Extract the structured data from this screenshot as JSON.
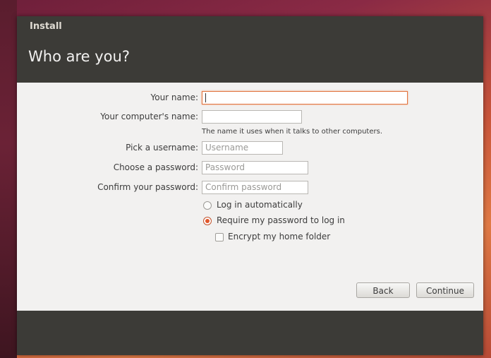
{
  "window": {
    "title": "Install"
  },
  "page": {
    "title": "Who are you?"
  },
  "form": {
    "name_label": "Your name:",
    "name_value": "",
    "computer_label": "Your computer's name:",
    "computer_value": "",
    "computer_hint": "The name it uses when it talks to other computers.",
    "username_label": "Pick a username:",
    "username_placeholder": "Username",
    "password_label": "Choose a password:",
    "password_placeholder": "Password",
    "confirm_label": "Confirm your password:",
    "confirm_placeholder": "Confirm password"
  },
  "login_options": {
    "auto_label": "Log in automatically",
    "auto_selected": false,
    "require_label": "Require my password to log in",
    "require_selected": true,
    "encrypt_label": "Encrypt my home folder",
    "encrypt_checked": false
  },
  "buttons": {
    "back": "Back",
    "continue": "Continue"
  },
  "colors": {
    "accent": "#e2572a",
    "header_bg": "#3c3b37",
    "content_bg": "#f2f1f0"
  }
}
